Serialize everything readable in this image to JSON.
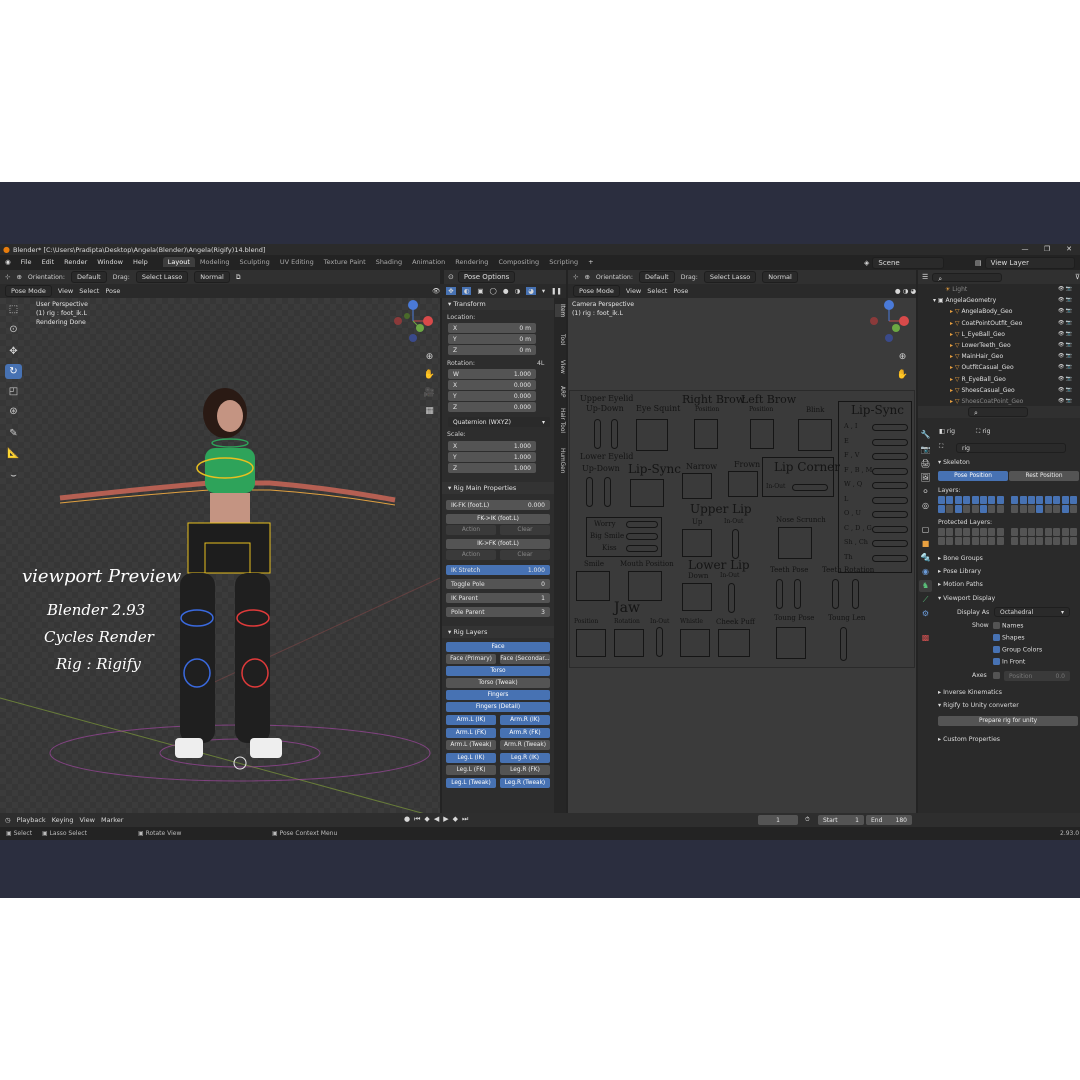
{
  "window": {
    "title": "Blender* [C:\\Users\\Pradipta\\Desktop\\Angela(Blender)\\Angela(Rigify)14.blend]"
  },
  "menu": [
    "File",
    "Edit",
    "Render",
    "Window",
    "Help"
  ],
  "workspaces": [
    "Layout",
    "Modeling",
    "Sculpting",
    "UV Editing",
    "Texture Paint",
    "Shading",
    "Animation",
    "Rendering",
    "Compositing",
    "Scripting"
  ],
  "scene": {
    "scene_label": "Scene",
    "view_layer_label": "View Layer"
  },
  "left_viewport": {
    "orientation_label": "Orientation:",
    "orientation_value": "Default",
    "drag_label": "Drag:",
    "drag_value": "Select Lasso",
    "pivot_value": "Normal",
    "mode": "Pose Mode",
    "menus": [
      "View",
      "Select",
      "Pose"
    ],
    "info_line1": "User Perspective",
    "info_line2": "(1) rig : foot_ik.L",
    "info_line3": "Rendering Done",
    "overlay_lines": [
      "viewport Preview",
      "Blender 2.93",
      "Cycles Render",
      "Rig : Rigify"
    ]
  },
  "npanel": {
    "pose_options": "Pose Options",
    "transform_title": "Transform",
    "location_label": "Location:",
    "location": [
      {
        "axis": "X",
        "value": "0 m"
      },
      {
        "axis": "Y",
        "value": "0 m"
      },
      {
        "axis": "Z",
        "value": "0 m"
      }
    ],
    "rotation_label": "Rotation:",
    "rotation_mode_short": "4L",
    "rotation": [
      {
        "axis": "W",
        "value": "1.000"
      },
      {
        "axis": "X",
        "value": "0.000"
      },
      {
        "axis": "Y",
        "value": "0.000"
      },
      {
        "axis": "Z",
        "value": "0.000"
      }
    ],
    "rotation_mode": "Quaternion (WXYZ)",
    "scale_label": "Scale:",
    "scale": [
      {
        "axis": "X",
        "value": "1.000"
      },
      {
        "axis": "Y",
        "value": "1.000"
      },
      {
        "axis": "Z",
        "value": "1.000"
      }
    ],
    "rig_main_title": "Rig Main Properties",
    "ikfk_label": "IK-FK (foot.L)",
    "ikfk_value": "0.000",
    "fk_ik": "FK->IK (foot.L)",
    "ik_fk": "IK->FK (foot.L)",
    "action": "Action",
    "clear": "Clear",
    "ik_stretch_label": "IK Stretch",
    "ik_stretch_value": "1.000",
    "toggle_pole": "Toggle Pole",
    "toggle_pole_value": "0",
    "ik_parent": "IK Parent",
    "ik_parent_value": "1",
    "pole_parent": "Pole Parent",
    "pole_parent_value": "3",
    "rig_layers_title": "Rig Layers",
    "layers_full": [
      "Face",
      "Torso",
      "Torso (Tweak)",
      "Fingers",
      "Fingers (Detail)"
    ],
    "layers_pairs": [
      [
        "Face (Primary)",
        "Face (Secondar..."
      ],
      [
        "Arm.L (IK)",
        "Arm.R (IK)"
      ],
      [
        "Arm.L (FK)",
        "Arm.R (FK)"
      ],
      [
        "Arm.L (Tweak)",
        "Arm.R (Tweak)"
      ],
      [
        "Leg.L (IK)",
        "Leg.R (IK)"
      ],
      [
        "Leg.L (FK)",
        "Leg.R (FK)"
      ],
      [
        "Leg.L (Tweak)",
        "Leg.R (Tweak)"
      ]
    ],
    "tabs": [
      "Item",
      "Tool",
      "View",
      "ARP",
      "Hair Tool",
      "HumGen"
    ]
  },
  "right_viewport": {
    "info_line1": "Camera Perspective",
    "info_line2": "(1) rig : foot_ik.L",
    "face_labels": {
      "upper_eyelid": "Upper Eyelid",
      "up_down_1": "Up-Down",
      "eye_squint": "Eye Squint",
      "right_brow": "Right Brow",
      "left_brow": "Left Brow",
      "position_1": "Position",
      "position_2": "Position",
      "blink": "Blink",
      "lip_sync_title": "Lip-Sync",
      "lower_eyelid": "Lower Eyelid",
      "up_down_2": "Up-Down",
      "lip_sync_mid": "Lip-Sync",
      "narrow": "Narrow",
      "frown": "Frown",
      "lip_corner": "Lip Corner",
      "in_out_1": "In-Out",
      "upper_lip": "Upper Lip",
      "up": "Up",
      "in_out_2": "In-Out",
      "nose_scrunch": "Nose Scrunch",
      "worry": "Worry",
      "big_smile": "Big Smile",
      "kiss": "Kiss",
      "smile": "Smile",
      "mouth_position": "Mouth Position",
      "lower_lip": "Lower Lip",
      "down": "Down",
      "in_out_3": "In-Out",
      "teeth_pose": "Teeth Pose",
      "teeth_rotation": "Teeth Rotation",
      "jaw": "Jaw",
      "position_3": "Position",
      "rotation": "Rotation",
      "in_out_4": "In-Out",
      "whistle": "Whistle",
      "cheek_puff": "Cheek Puff",
      "toung_pose": "Toung Pose",
      "toung_len": "Toung Len",
      "visemes": [
        "A , I",
        "E",
        "F , V",
        "F , B , M",
        "W , Q",
        "L",
        "O , U",
        "C , D , G",
        "Sh , Ch",
        "Th"
      ]
    }
  },
  "outliner": {
    "items": [
      "Light",
      "AngelaGeometry",
      "AngelaBody_Geo",
      "CoatPointOutfit_Geo",
      "L_EyeBall_Geo",
      "LowerTeeth_Geo",
      "MainHair_Geo",
      "OutfitCasual_Geo",
      "R_EyeBall_Geo",
      "ShoesCasual_Geo",
      "ShoesCoatPoint_Geo"
    ]
  },
  "properties": {
    "object_name": "rig",
    "data_name": "rig",
    "armature_name": "rig",
    "skeleton_title": "Skeleton",
    "pose_position": "Pose Position",
    "rest_position": "Rest Position",
    "layers_label": "Layers:",
    "protected_layers_label": "Protected Layers:",
    "sections": [
      "Bone Groups",
      "Pose Library",
      "Motion Paths"
    ],
    "viewport_display_title": "Viewport Display",
    "display_as_label": "Display As",
    "display_as_value": "Octahedral",
    "show_label": "Show",
    "names": "Names",
    "shapes": "Shapes",
    "group_colors": "Group Colors",
    "in_front": "In Front",
    "axes_label": "Axes",
    "position_label": "Position",
    "position_value": "0.0",
    "inverse_kinematics": "Inverse Kinematics",
    "rigify_unity": "Rigify to Unity converter",
    "prepare_rig": "Prepare rig for unity",
    "custom_properties": "Custom Properties"
  },
  "timeline": {
    "menus": [
      "Playback",
      "Keying",
      "View",
      "Marker"
    ],
    "current_frame": "1",
    "start_label": "Start",
    "start_value": "1",
    "end_label": "End",
    "end_value": "180"
  },
  "statusbar": {
    "select": "Select",
    "lasso": "Lasso Select",
    "rotate": "Rotate View",
    "context": "Pose Context Menu",
    "version": "2.93.0"
  },
  "colors": {
    "accent": "#4772b3",
    "bg": "#232323",
    "frame": "#2b2e3f"
  }
}
